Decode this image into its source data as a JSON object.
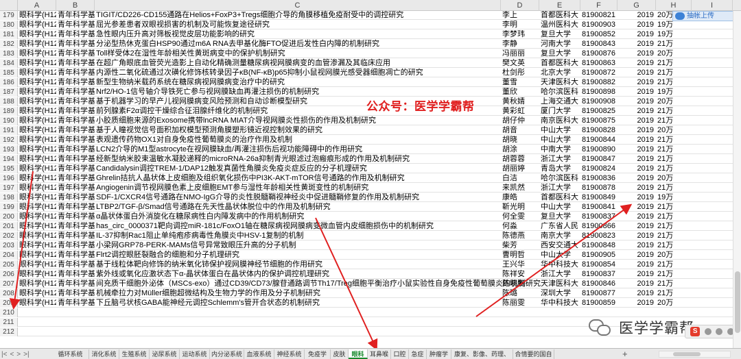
{
  "columns": [
    "A",
    "B",
    "C",
    "D",
    "E",
    "F",
    "G",
    "H",
    "I"
  ],
  "cloud_button": "抽帐上传",
  "watermark": "公众号：医学学霸帮",
  "logo_text": "医学学霸帮",
  "ime_label": "S",
  "rows": [
    {
      "n": "179",
      "a": "眼科学(H12",
      "b": "青年科学基",
      "c": "TIGIT/CD226-CD155通路在Helios+FoxP3+Tregs细胞介导的角膜移植免疫耐受中的调控研究",
      "d": "李上",
      "e": "首都医科大",
      "f": "81900821",
      "g": "2019",
      "h": "20万"
    },
    {
      "n": "180",
      "a": "眼科学(H12",
      "b": "青年科学基",
      "c": "屈光参差患者双眼视损害的机制及可能恢复途径研究",
      "d": "李明",
      "e": "温州医科大",
      "f": "81900903",
      "g": "2019",
      "h": "19万"
    },
    {
      "n": "181",
      "a": "眼科学(H12",
      "b": "青年科学基",
      "c": "急性眼内压升高对筛板视觉皮层功能影响的研究",
      "d": "李梦玮",
      "e": "复旦大学",
      "f": "81900852",
      "g": "2019",
      "h": "19万"
    },
    {
      "n": "182",
      "a": "眼科学(H12",
      "b": "青年科学基",
      "c": "分泌型热休克蛋白HSP90通过m6A RNA去甲基化酶FTO促进后发性白内障的机制研究",
      "d": "李静",
      "e": "河南大学",
      "f": "81900843",
      "g": "2019",
      "h": "21万"
    },
    {
      "n": "183",
      "a": "眼科学(H12",
      "b": "青年科学基",
      "c": "Toll样受体2在湿性年龄相关性黄斑病变中的保护机制研究",
      "d": "冯丽丽",
      "e": "复旦大学",
      "f": "81900876",
      "g": "2019",
      "h": "20万"
    },
    {
      "n": "184",
      "a": "眼科学(H12",
      "b": "青年科学基",
      "c": "在超广角眼底血管荧光造影上自动化精确测量糖尿病视网膜病变的血管渗漏及其临床应用",
      "d": "樊文英",
      "e": "首都医科大",
      "f": "81900863",
      "g": "2019",
      "h": "21万"
    },
    {
      "n": "185",
      "a": "眼科学(H12",
      "b": "青年科学基",
      "c": "内源性二氧化硫通过次磺化修饰核转录因子κB(NF-κB)p65抑制小鼠视网膜光感受器细胞凋亡的研究",
      "d": "杜剑彤",
      "e": "北京大学",
      "f": "81900872",
      "g": "2019",
      "h": "21万"
    },
    {
      "n": "186",
      "a": "眼科学(H12",
      "b": "青年科学基",
      "c": "新型生物纳米载药系统在糖尿病视网膜病变治疗中的研究",
      "d": "董雪",
      "e": "天津医科大",
      "f": "81900882",
      "g": "2019",
      "h": "21万"
    },
    {
      "n": "187",
      "a": "眼科学(H12",
      "b": "青年科学基",
      "c": "Nrf2/HO-1信号轴介导铁死亡参与视网膜缺血再灌注损伤的机制研究",
      "d": "董欣",
      "e": "哈尔滨医科",
      "f": "81900898",
      "g": "2019",
      "h": "19万"
    },
    {
      "n": "188",
      "a": "眼科学(H12",
      "b": "青年科学基",
      "c": "基于机器学习的早产儿视网膜病变风险预测和自动诊断模型研究",
      "d": "黄秋婧",
      "e": "上海交通大",
      "f": "81900908",
      "g": "2019",
      "h": "20万"
    },
    {
      "n": "189",
      "a": "眼科学(H12",
      "b": "青年科学基",
      "c": "前列腺素F2α调控干燥综合征泪腺纤维化的机制研究",
      "d": "黄彩虹",
      "e": "厦门大学",
      "f": "81900825",
      "g": "2019",
      "h": "21万"
    },
    {
      "n": "190",
      "a": "眼科学(H12",
      "b": "青年科学基",
      "c": "小胶质细胞来源的Exosome携带lncRNA MIAT介导视网膜炎性损伤的作用及机制研究",
      "d": "胡仔仲",
      "e": "南京医科大",
      "f": "81900875",
      "g": "2019",
      "h": "21万"
    },
    {
      "n": "191",
      "a": "眼科学(H12",
      "b": "青年科学基",
      "c": "基于人瞳视觉信号面积加权模型预测角膜塑形镜近视控制效果的研究",
      "d": "胡音",
      "e": "中山大学",
      "f": "81900828",
      "g": "2019",
      "h": "20万"
    },
    {
      "n": "192",
      "a": "眼科学(H12",
      "b": "青年科学基",
      "c": "表观遗传药物OX1对自身免疫性葡萄膜炎的治疗作用及机制",
      "d": "胡晓",
      "e": "中山大学",
      "f": "81900844",
      "g": "2019",
      "h": "21万"
    },
    {
      "n": "193",
      "a": "眼科学(H12",
      "b": "青年科学基",
      "c": "LCN2介导的M1型astrocyte在视网膜缺血/再灌注损伤后视功能障碍中的作用研究",
      "d": "胡涂",
      "e": "中南大学",
      "f": "81900890",
      "g": "2019",
      "h": "21万"
    },
    {
      "n": "194",
      "a": "眼科学(H12",
      "b": "青年科学基",
      "c": "经新型纳米胶束温敏水凝胶递释的microRNA-26a抑制青光眼滤过泡瘢痕形成的作用及机制研究",
      "d": "胡蓉蓉",
      "e": "浙江大学",
      "f": "81900847",
      "g": "2019",
      "h": "21万"
    },
    {
      "n": "195",
      "a": "眼科学(H12",
      "b": "青年科学基",
      "c": "Candidalysin调控TREM-1/DAP12触发真菌性角膜炎免疫炎症反应的分子机理研究",
      "d": "胡丽婷",
      "e": "青岛大学",
      "f": "81900824",
      "g": "2019",
      "h": "21万"
    },
    {
      "n": "196",
      "a": "眼科学(H12",
      "b": "青年科学基",
      "c": "Ghrelin拮抗人晶状体上皮细胞及组织氧化损伤中PI3K-AKT-mTOR信号通路的作用及机制研究",
      "d": "白洁",
      "e": "哈尔滨医科",
      "f": "81900836",
      "g": "2019",
      "h": "20万"
    },
    {
      "n": "197",
      "a": "眼科学(H12",
      "b": "青年科学基",
      "c": "Angiogenin调节视网膜色素上皮细胞EMT参与湿性年龄相关性黄斑变性的机制研究",
      "d": "来凯然",
      "e": "浙江大学",
      "f": "81900878",
      "g": "2019",
      "h": "21万"
    },
    {
      "n": "198",
      "a": "眼科学(H12",
      "b": "青年科学基",
      "c": "SDF-1/CXCR4信号通路在NMO-IgG介导的炎性脱髓鞘视神经炎中促进髓鞘修复的作用及机制研究",
      "d": "康皓",
      "e": "首都医科大",
      "f": "81900849",
      "g": "2019",
      "h": "19万"
    },
    {
      "n": "199",
      "a": "眼科学(H12",
      "b": "青年科学基",
      "c": "LTBP2/TGF-β/Smad信号通路在先天性晶状体脱位中的作用及机制研究",
      "d": "靳光明",
      "e": "中山大学",
      "f": "81900841",
      "g": "2019",
      "h": "21万"
    },
    {
      "n": "200",
      "a": "眼科学(H12",
      "b": "青年科学基",
      "c": "α晶状体蛋白外消旋化在糖尿病性白内障发病中的作用机制研究",
      "d": "何全雯",
      "e": "复旦大学",
      "f": "81900837",
      "g": "2019",
      "h": "21万"
    },
    {
      "n": "201",
      "a": "眼科学(H12",
      "b": "青年科学基",
      "c": "has_circ_0000371靶向调控miR-181c/FoxO1轴在糖尿病视网膜病变微血管内皮细胞损伤中的机制研究",
      "d": "何淼",
      "e": "广东省人民",
      "f": "81900866",
      "g": "2019",
      "h": "21万"
    },
    {
      "n": "202",
      "a": "眼科学(H12",
      "b": "青年科学基",
      "c": "IL-37抑制Rac1阻止单纯疱疹病毒性角膜炎中HSV-1复制的机制",
      "d": "陈德燕",
      "e": "南京大学",
      "f": "81900823",
      "g": "2019",
      "h": "21万"
    },
    {
      "n": "203",
      "a": "眼科学(H12",
      "b": "青年科学基",
      "c": "小梁网GRP78-PERK-MAMs信号异常致眼压升高的分子机制",
      "d": "柴芳",
      "e": "西安交通大",
      "f": "81900848",
      "g": "2019",
      "h": "21万"
    },
    {
      "n": "204",
      "a": "眼科学(H12",
      "b": "青年科学基",
      "c": "Flrt2调控眼胚裂融合的细胞和分子机理研究",
      "d": "曹明哲",
      "e": "中山大学",
      "f": "81900905",
      "g": "2019",
      "h": "20万"
    },
    {
      "n": "205",
      "a": "眼科学(H12",
      "b": "青年科学基",
      "c": "基于线粒体靶向修饰的纳米氧化铈保护视网膜神经节细胞的作用研究",
      "d": "王兴华",
      "e": "华中科技大",
      "f": "81900854",
      "g": "2019",
      "h": "21万"
    },
    {
      "n": "206",
      "a": "眼科学(H12",
      "b": "青年科学基",
      "c": "紫外线或氧化应激状态下α-晶状体蛋白在晶状体内的保护调控机理研究",
      "d": "陈祥安",
      "e": "浙江大学",
      "f": "81900837",
      "g": "2019",
      "h": "21万"
    },
    {
      "n": "207",
      "a": "眼科学(H12",
      "b": "青年科学基",
      "c": "间充质干细胞外泌体（MSCs-exo）通过CD39/CD73/腺苷通路调节Th17/Treg细胞平衡治疗小鼠实验性自身免疫性葡萄膜炎的机制研究",
      "d": "陈晓腾",
      "e": "天津医科大",
      "f": "81900846",
      "g": "2019",
      "h": "21万"
    },
    {
      "n": "208",
      "a": "眼科学(H12",
      "b": "青年科学基",
      "c": "机械牵拉力对Müller细胞超微结构及生物力学的作用及分子机制研究",
      "d": "陈璐",
      "e": "深圳大学",
      "f": "81900877",
      "g": "2019",
      "h": "21万"
    },
    {
      "n": "209",
      "a": "眼科学(H12",
      "b": "青年科学基",
      "c": "下丘脑弓状核GABA能神经元调控Schlemm's管开合状态的机制研究",
      "d": "陈丽雯",
      "e": "华中科技大",
      "f": "81900859",
      "g": "2019",
      "h": "20万"
    },
    {
      "n": "210",
      "a": "",
      "b": "",
      "c": "",
      "d": "",
      "e": "",
      "f": "",
      "g": "",
      "h": ""
    },
    {
      "n": "211",
      "a": "",
      "b": "",
      "c": "",
      "d": "",
      "e": "",
      "f": "",
      "g": "",
      "h": ""
    },
    {
      "n": "212",
      "a": "",
      "b": "",
      "c": "",
      "d": "",
      "e": "",
      "f": "",
      "g": "",
      "h": ""
    }
  ],
  "tabs": [
    "循环系统",
    "消化系统",
    "生殖系统",
    "泌尿系统",
    "运动系统",
    "内分泌系统",
    "血液系统",
    "神经系统",
    "免疫学",
    "皮肤",
    "眼科",
    "耳鼻喉",
    "口腔",
    "急症",
    "肿瘤学",
    "康复、影像、药理、中医",
    "合情要的国自然"
  ],
  "active_tab": "眼科",
  "tab_nav": [
    "|<",
    "<",
    ">",
    ">|"
  ],
  "tab_add": "+",
  "colors": {
    "watermark": "#e02020",
    "arrow": "#e02020",
    "active_tab": "#1a8a2e",
    "header_bg": "#e9e9e9"
  },
  "icons": [
    "cloud-upload-icon",
    "wechat-logo-icon",
    "ime-icon"
  ]
}
